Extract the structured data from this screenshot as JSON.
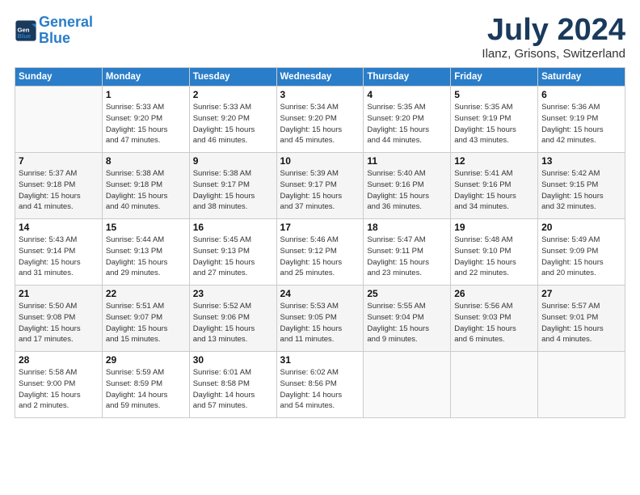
{
  "header": {
    "logo_line1": "General",
    "logo_line2": "Blue",
    "month": "July 2024",
    "location": "Ilanz, Grisons, Switzerland"
  },
  "columns": [
    "Sunday",
    "Monday",
    "Tuesday",
    "Wednesday",
    "Thursday",
    "Friday",
    "Saturday"
  ],
  "weeks": [
    [
      {
        "day": "",
        "info": ""
      },
      {
        "day": "1",
        "info": "Sunrise: 5:33 AM\nSunset: 9:20 PM\nDaylight: 15 hours\nand 47 minutes."
      },
      {
        "day": "2",
        "info": "Sunrise: 5:33 AM\nSunset: 9:20 PM\nDaylight: 15 hours\nand 46 minutes."
      },
      {
        "day": "3",
        "info": "Sunrise: 5:34 AM\nSunset: 9:20 PM\nDaylight: 15 hours\nand 45 minutes."
      },
      {
        "day": "4",
        "info": "Sunrise: 5:35 AM\nSunset: 9:20 PM\nDaylight: 15 hours\nand 44 minutes."
      },
      {
        "day": "5",
        "info": "Sunrise: 5:35 AM\nSunset: 9:19 PM\nDaylight: 15 hours\nand 43 minutes."
      },
      {
        "day": "6",
        "info": "Sunrise: 5:36 AM\nSunset: 9:19 PM\nDaylight: 15 hours\nand 42 minutes."
      }
    ],
    [
      {
        "day": "7",
        "info": "Sunrise: 5:37 AM\nSunset: 9:18 PM\nDaylight: 15 hours\nand 41 minutes."
      },
      {
        "day": "8",
        "info": "Sunrise: 5:38 AM\nSunset: 9:18 PM\nDaylight: 15 hours\nand 40 minutes."
      },
      {
        "day": "9",
        "info": "Sunrise: 5:38 AM\nSunset: 9:17 PM\nDaylight: 15 hours\nand 38 minutes."
      },
      {
        "day": "10",
        "info": "Sunrise: 5:39 AM\nSunset: 9:17 PM\nDaylight: 15 hours\nand 37 minutes."
      },
      {
        "day": "11",
        "info": "Sunrise: 5:40 AM\nSunset: 9:16 PM\nDaylight: 15 hours\nand 36 minutes."
      },
      {
        "day": "12",
        "info": "Sunrise: 5:41 AM\nSunset: 9:16 PM\nDaylight: 15 hours\nand 34 minutes."
      },
      {
        "day": "13",
        "info": "Sunrise: 5:42 AM\nSunset: 9:15 PM\nDaylight: 15 hours\nand 32 minutes."
      }
    ],
    [
      {
        "day": "14",
        "info": "Sunrise: 5:43 AM\nSunset: 9:14 PM\nDaylight: 15 hours\nand 31 minutes."
      },
      {
        "day": "15",
        "info": "Sunrise: 5:44 AM\nSunset: 9:13 PM\nDaylight: 15 hours\nand 29 minutes."
      },
      {
        "day": "16",
        "info": "Sunrise: 5:45 AM\nSunset: 9:13 PM\nDaylight: 15 hours\nand 27 minutes."
      },
      {
        "day": "17",
        "info": "Sunrise: 5:46 AM\nSunset: 9:12 PM\nDaylight: 15 hours\nand 25 minutes."
      },
      {
        "day": "18",
        "info": "Sunrise: 5:47 AM\nSunset: 9:11 PM\nDaylight: 15 hours\nand 23 minutes."
      },
      {
        "day": "19",
        "info": "Sunrise: 5:48 AM\nSunset: 9:10 PM\nDaylight: 15 hours\nand 22 minutes."
      },
      {
        "day": "20",
        "info": "Sunrise: 5:49 AM\nSunset: 9:09 PM\nDaylight: 15 hours\nand 20 minutes."
      }
    ],
    [
      {
        "day": "21",
        "info": "Sunrise: 5:50 AM\nSunset: 9:08 PM\nDaylight: 15 hours\nand 17 minutes."
      },
      {
        "day": "22",
        "info": "Sunrise: 5:51 AM\nSunset: 9:07 PM\nDaylight: 15 hours\nand 15 minutes."
      },
      {
        "day": "23",
        "info": "Sunrise: 5:52 AM\nSunset: 9:06 PM\nDaylight: 15 hours\nand 13 minutes."
      },
      {
        "day": "24",
        "info": "Sunrise: 5:53 AM\nSunset: 9:05 PM\nDaylight: 15 hours\nand 11 minutes."
      },
      {
        "day": "25",
        "info": "Sunrise: 5:55 AM\nSunset: 9:04 PM\nDaylight: 15 hours\nand 9 minutes."
      },
      {
        "day": "26",
        "info": "Sunrise: 5:56 AM\nSunset: 9:03 PM\nDaylight: 15 hours\nand 6 minutes."
      },
      {
        "day": "27",
        "info": "Sunrise: 5:57 AM\nSunset: 9:01 PM\nDaylight: 15 hours\nand 4 minutes."
      }
    ],
    [
      {
        "day": "28",
        "info": "Sunrise: 5:58 AM\nSunset: 9:00 PM\nDaylight: 15 hours\nand 2 minutes."
      },
      {
        "day": "29",
        "info": "Sunrise: 5:59 AM\nSunset: 8:59 PM\nDaylight: 14 hours\nand 59 minutes."
      },
      {
        "day": "30",
        "info": "Sunrise: 6:01 AM\nSunset: 8:58 PM\nDaylight: 14 hours\nand 57 minutes."
      },
      {
        "day": "31",
        "info": "Sunrise: 6:02 AM\nSunset: 8:56 PM\nDaylight: 14 hours\nand 54 minutes."
      },
      {
        "day": "",
        "info": ""
      },
      {
        "day": "",
        "info": ""
      },
      {
        "day": "",
        "info": ""
      }
    ]
  ]
}
